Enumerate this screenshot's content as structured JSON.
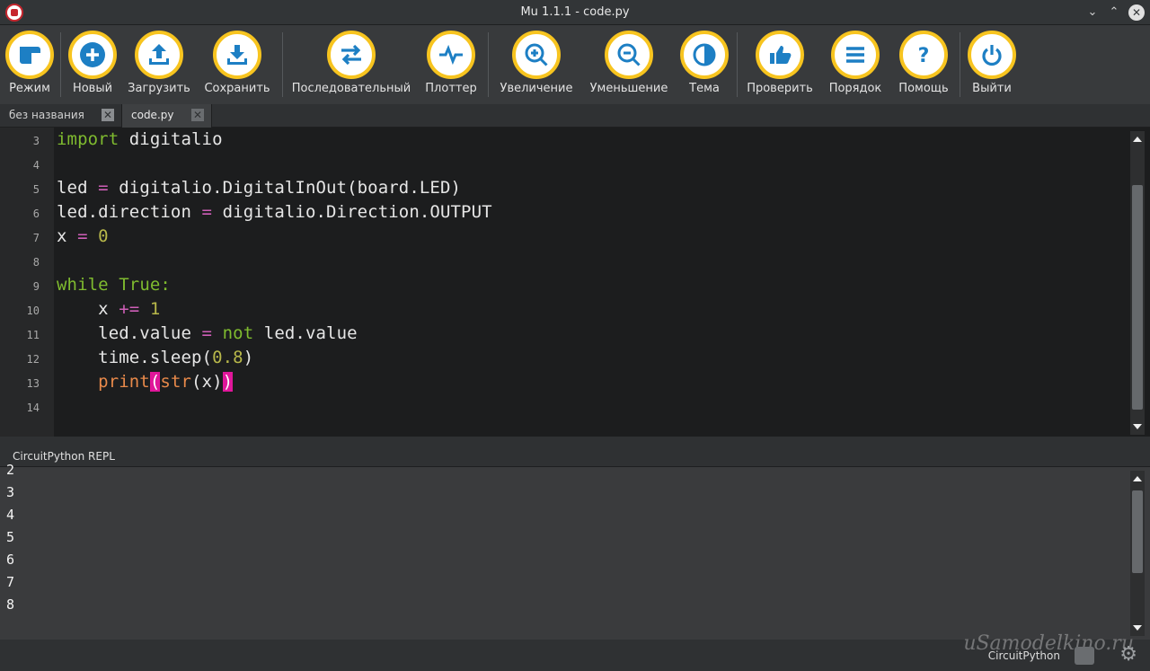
{
  "window": {
    "title": "Mu 1.1.1 - code.py",
    "minimize": "⌄",
    "maximize": "⌃",
    "close": "✕"
  },
  "toolbar": {
    "buttons": [
      {
        "id": "mode",
        "label": "Режим",
        "icon": "mode-icon"
      },
      {
        "id": "new",
        "label": "Новый",
        "icon": "plus-icon"
      },
      {
        "id": "load",
        "label": "Загрузить",
        "icon": "upload-icon"
      },
      {
        "id": "save",
        "label": "Сохранить",
        "icon": "download-icon"
      },
      {
        "id": "serial",
        "label": "Последовательный",
        "icon": "swap-arrows-icon"
      },
      {
        "id": "plotter",
        "label": "Плоттер",
        "icon": "pulse-icon"
      },
      {
        "id": "zoomin",
        "label": "Увеличение",
        "icon": "zoom-in-icon"
      },
      {
        "id": "zoomout",
        "label": "Уменьшение",
        "icon": "zoom-out-icon"
      },
      {
        "id": "theme",
        "label": "Тема",
        "icon": "contrast-icon"
      },
      {
        "id": "check",
        "label": "Проверить",
        "icon": "thumbs-up-icon"
      },
      {
        "id": "tidy",
        "label": "Порядок",
        "icon": "lines-icon"
      },
      {
        "id": "help",
        "label": "Помощь",
        "icon": "question-icon"
      },
      {
        "id": "quit",
        "label": "Выйти",
        "icon": "power-icon"
      }
    ]
  },
  "tabs": [
    {
      "label": "без названия",
      "close": "✕"
    },
    {
      "label": "code.py",
      "close": "✕"
    }
  ],
  "editor": {
    "line_numbers": [
      "3",
      "4",
      "5",
      "6",
      "7",
      "8",
      "9",
      "10",
      "11",
      "12",
      "13",
      "14"
    ],
    "lines": {
      "l3a": "import",
      "l3b": " digitalio",
      "l5a": "led ",
      "l5b": "=",
      "l5c": " digitalio.DigitalInOut(board.LED)",
      "l6a": "led.direction ",
      "l6b": "=",
      "l6c": " digitalio.Direction.OUTPUT",
      "l7a": "x ",
      "l7b": "=",
      "l7c": " ",
      "l7d": "0",
      "l9a": "while",
      "l9b": " ",
      "l9c": "True:",
      "l10a": "    x ",
      "l10b": "+=",
      "l10c": " ",
      "l10d": "1",
      "l11a": "    led.value ",
      "l11b": "=",
      "l11c": " ",
      "l11d": "not",
      "l11e": " led.value",
      "l12a": "    time.sleep(",
      "l12b": "0.8",
      "l12c": ")",
      "l13a": "    ",
      "l13b": "print",
      "l13c": "(",
      "l13d": "str",
      "l13e": "(x)",
      "l13f": ")"
    }
  },
  "repl": {
    "header": "CircuitPython REPL",
    "lines": [
      "2",
      "3",
      "4",
      "5",
      "6",
      "7",
      "8"
    ]
  },
  "status": {
    "mode": "CircuitPython",
    "watermark": "uSamodelkino.ru"
  },
  "colors": {
    "accent": "#f7c41f",
    "keyword": "#7fbb2f",
    "builtin": "#e8894a",
    "operator": "#cf5fb8",
    "number": "#b8b84a",
    "bracket_match": "#e0169a"
  }
}
